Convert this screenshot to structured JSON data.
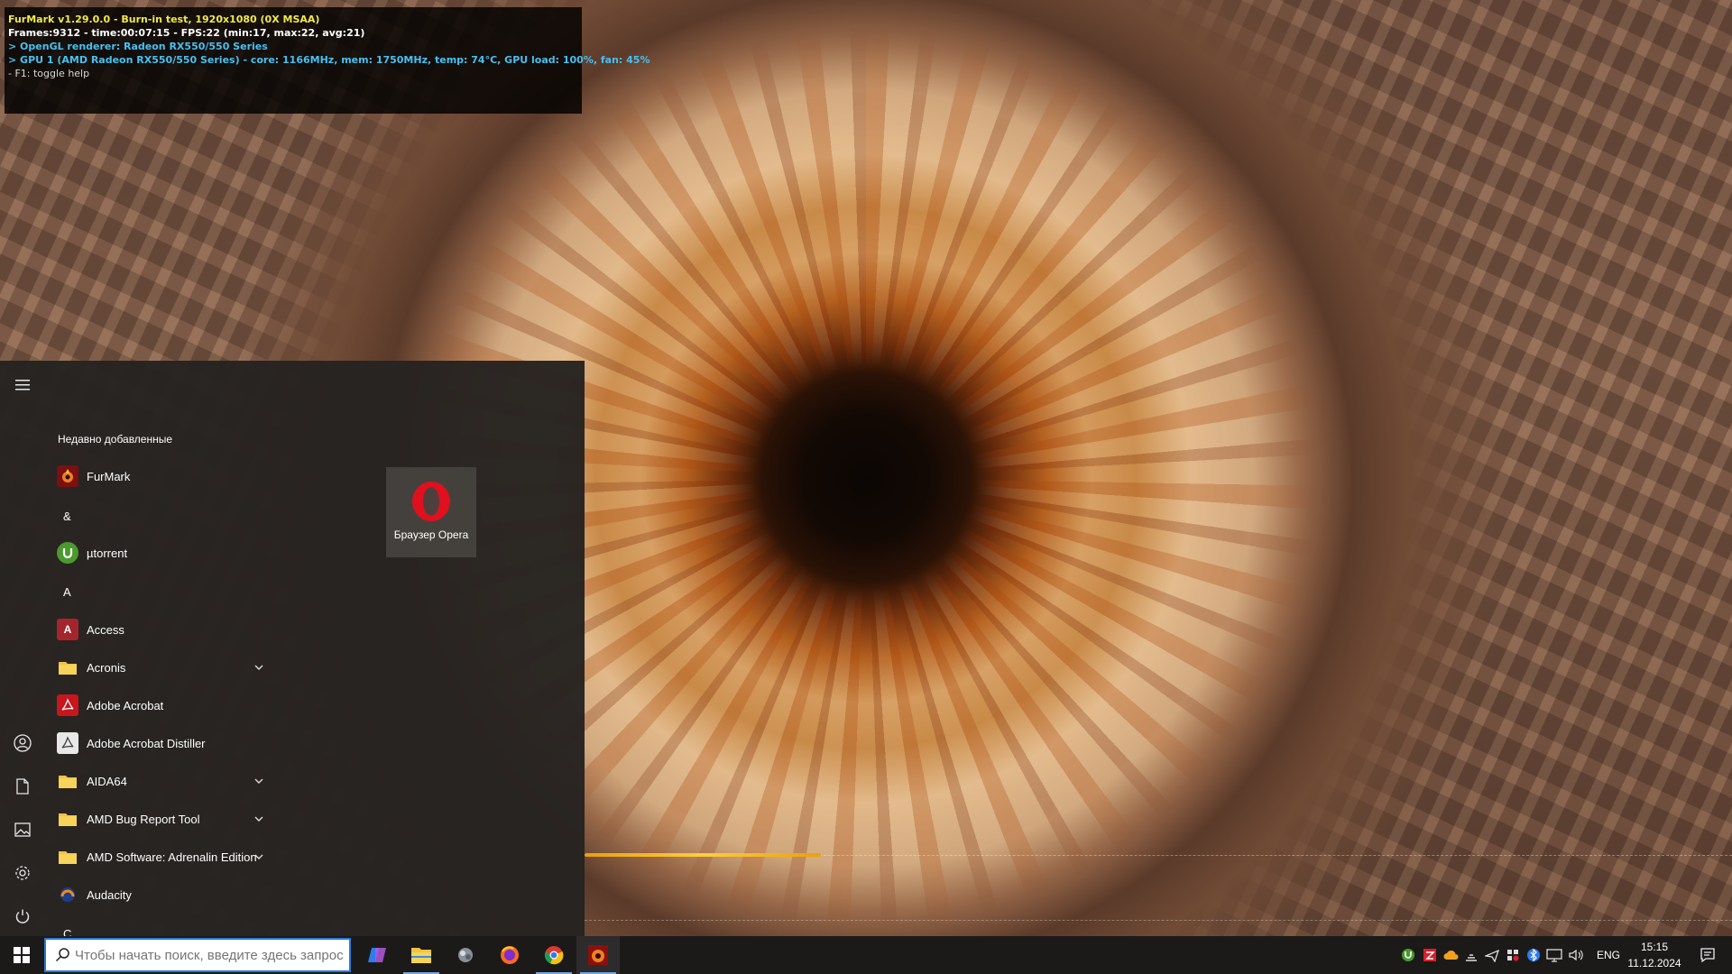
{
  "furmark_overlay": {
    "line1": "FurMark v1.29.0.0 - Burn-in test, 1920x1080 (0X MSAA)",
    "line2": "Frames:9312 - time:00:07:15 - FPS:22 (min:17, max:22, avg:21)",
    "line3": "> OpenGL renderer: Radeon RX550/550 Series",
    "line4": "> GPU 1 (AMD Radeon RX550/550 Series) - core: 1166MHz, mem: 1750MHz, temp: 74°C, GPU load: 100%, fan: 45%",
    "line5": "- F1: toggle help"
  },
  "start_menu": {
    "section_title": "Недавно добавленные",
    "items": [
      {
        "label": "FurMark",
        "icon": "furmark-icon",
        "kind": "app"
      },
      {
        "label": "&",
        "kind": "letter"
      },
      {
        "label": "µtorrent",
        "icon": "utorrent-icon",
        "kind": "app"
      },
      {
        "label": "A",
        "kind": "letter"
      },
      {
        "label": "Access",
        "icon": "access-icon",
        "kind": "app"
      },
      {
        "label": "Acronis",
        "icon": "folder-icon",
        "kind": "folder"
      },
      {
        "label": "Adobe Acrobat",
        "icon": "acrobat-icon",
        "kind": "app"
      },
      {
        "label": "Adobe Acrobat Distiller",
        "icon": "distiller-icon",
        "kind": "app"
      },
      {
        "label": "AIDA64",
        "icon": "folder-icon",
        "kind": "folder"
      },
      {
        "label": "AMD Bug Report Tool",
        "icon": "folder-icon",
        "kind": "folder"
      },
      {
        "label": "AMD Software: Adrenalin Edition",
        "icon": "folder-icon",
        "kind": "folder"
      },
      {
        "label": "Audacity",
        "icon": "audacity-icon",
        "kind": "app"
      },
      {
        "label": "C",
        "kind": "letter"
      }
    ],
    "tile": {
      "label": "Браузер Opera",
      "icon": "opera-icon"
    }
  },
  "taskbar": {
    "search_placeholder": "Чтобы начать поиск, введите здесь запрос",
    "apps": [
      "copilot-icon",
      "file-explorer-icon",
      "app-icon",
      "firefox-icon",
      "chrome-icon",
      "furmark-icon"
    ],
    "language": "ENG",
    "time": "15:15",
    "date": "11.12.2024"
  },
  "colors": {
    "accent": "#2b79d6",
    "start_bg": "#262321",
    "taskbar_bg": "#1c1a19",
    "overlay_yellow": "#f2e94a",
    "overlay_cyan": "#48c0f0"
  }
}
